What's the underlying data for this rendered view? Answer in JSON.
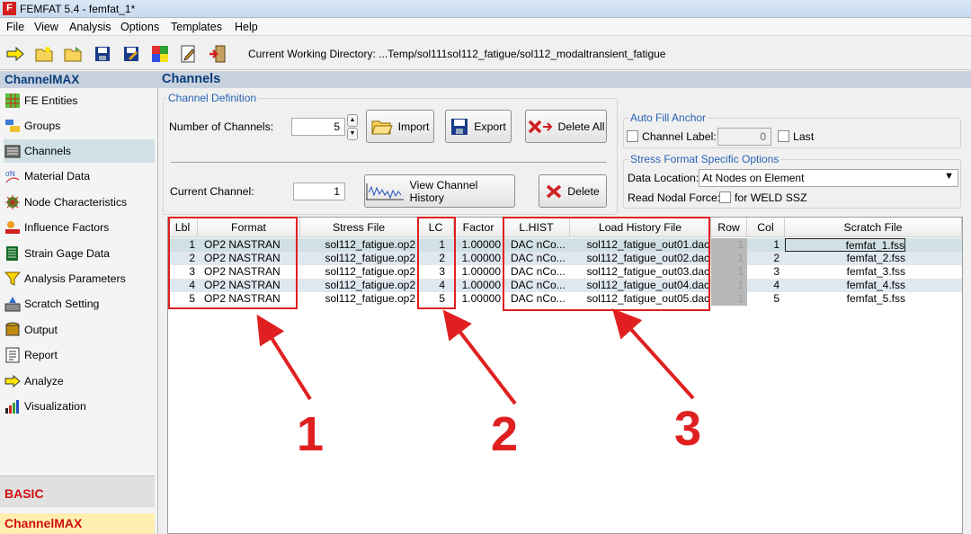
{
  "window": {
    "title": "FEMFAT 5.4 - femfat_1*",
    "logo": "F"
  },
  "menu": [
    "File",
    "View",
    "Analysis",
    "Options",
    "Templates",
    "Help"
  ],
  "toolbar": {
    "cwd_label": "Current Working Directory: ...Temp/sol111sol112_fatigue/sol112_modaltransient_fatigue"
  },
  "left": {
    "header": "ChannelMAX",
    "items": [
      {
        "label": "FE Entities",
        "icon": "fe-entities-icon"
      },
      {
        "label": "Groups",
        "icon": "groups-icon"
      },
      {
        "label": "Channels",
        "icon": "channels-icon"
      },
      {
        "label": "Material Data",
        "icon": "material-data-icon"
      },
      {
        "label": "Node Characteristics",
        "icon": "node-characteristics-icon"
      },
      {
        "label": "Influence Factors",
        "icon": "influence-factors-icon"
      },
      {
        "label": "Strain Gage Data",
        "icon": "strain-gage-icon"
      },
      {
        "label": "Analysis Parameters",
        "icon": "funnel-icon"
      },
      {
        "label": "Scratch Setting",
        "icon": "scratch-setting-icon"
      },
      {
        "label": "Output",
        "icon": "output-icon"
      },
      {
        "label": "Report",
        "icon": "report-icon"
      },
      {
        "label": "Analyze",
        "icon": "arrow-right-icon"
      },
      {
        "label": "Visualization",
        "icon": "bar-chart-icon"
      }
    ],
    "basic": "BASIC",
    "channelmax": "ChannelMAX"
  },
  "main": {
    "header": "Channels",
    "channel_definition": {
      "title": "Channel Definition",
      "num_channels_label": "Number of Channels:",
      "num_channels_value": "5",
      "import_label": "Import",
      "export_label": "Export",
      "delete_all_label": "Delete All",
      "current_channel_label": "Current Channel:",
      "current_channel_value": "1",
      "view_history_label": "View Channel History",
      "delete_label": "Delete"
    },
    "auto_fill": {
      "title": "Auto Fill Anchor",
      "channel_label": "Channel Label:",
      "channel_label_value": "0",
      "last_label": "Last"
    },
    "stress_format": {
      "title": "Stress Format Specific Options",
      "data_location_label": "Data Location:",
      "data_location_value": "At Nodes on Element",
      "read_nodal_label": "Read Nodal Force:",
      "weld_label": "for WELD SSZ"
    }
  },
  "grid": {
    "headers": [
      "Lbl",
      "Format",
      "Stress File",
      "LC",
      "Factor",
      "L.HIST",
      "Load History File",
      "Row",
      "Col",
      "Scratch File"
    ],
    "rows": [
      [
        "1",
        "OP2 NASTRAN",
        "sol112_fatigue.op2",
        "1",
        "1.00000",
        "DAC nCo...",
        "sol112_fatigue_out01.dac",
        "1",
        "1",
        "femfat_1.fss"
      ],
      [
        "2",
        "OP2 NASTRAN",
        "sol112_fatigue.op2",
        "2",
        "1.00000",
        "DAC nCo...",
        "sol112_fatigue_out02.dac",
        "1",
        "2",
        "femfat_2.fss"
      ],
      [
        "3",
        "OP2 NASTRAN",
        "sol112_fatigue.op2",
        "3",
        "1.00000",
        "DAC nCo...",
        "sol112_fatigue_out03.dac",
        "1",
        "3",
        "femfat_3.fss"
      ],
      [
        "4",
        "OP2 NASTRAN",
        "sol112_fatigue.op2",
        "4",
        "1.00000",
        "DAC nCo...",
        "sol112_fatigue_out04.dac",
        "1",
        "4",
        "femfat_4.fss"
      ],
      [
        "5",
        "OP2 NASTRAN",
        "sol112_fatigue.op2",
        "5",
        "1.00000",
        "DAC nCo...",
        "sol112_fatigue_out05.dac",
        "1",
        "5",
        "femfat_5.fss"
      ]
    ]
  },
  "annotations": [
    "1",
    "2",
    "3"
  ],
  "colors": {
    "accent_blue": "#2a62b4",
    "header_navy": "#0b3d7a",
    "annotation_red": "#e02020",
    "selected_row": "#d1e0e4"
  }
}
